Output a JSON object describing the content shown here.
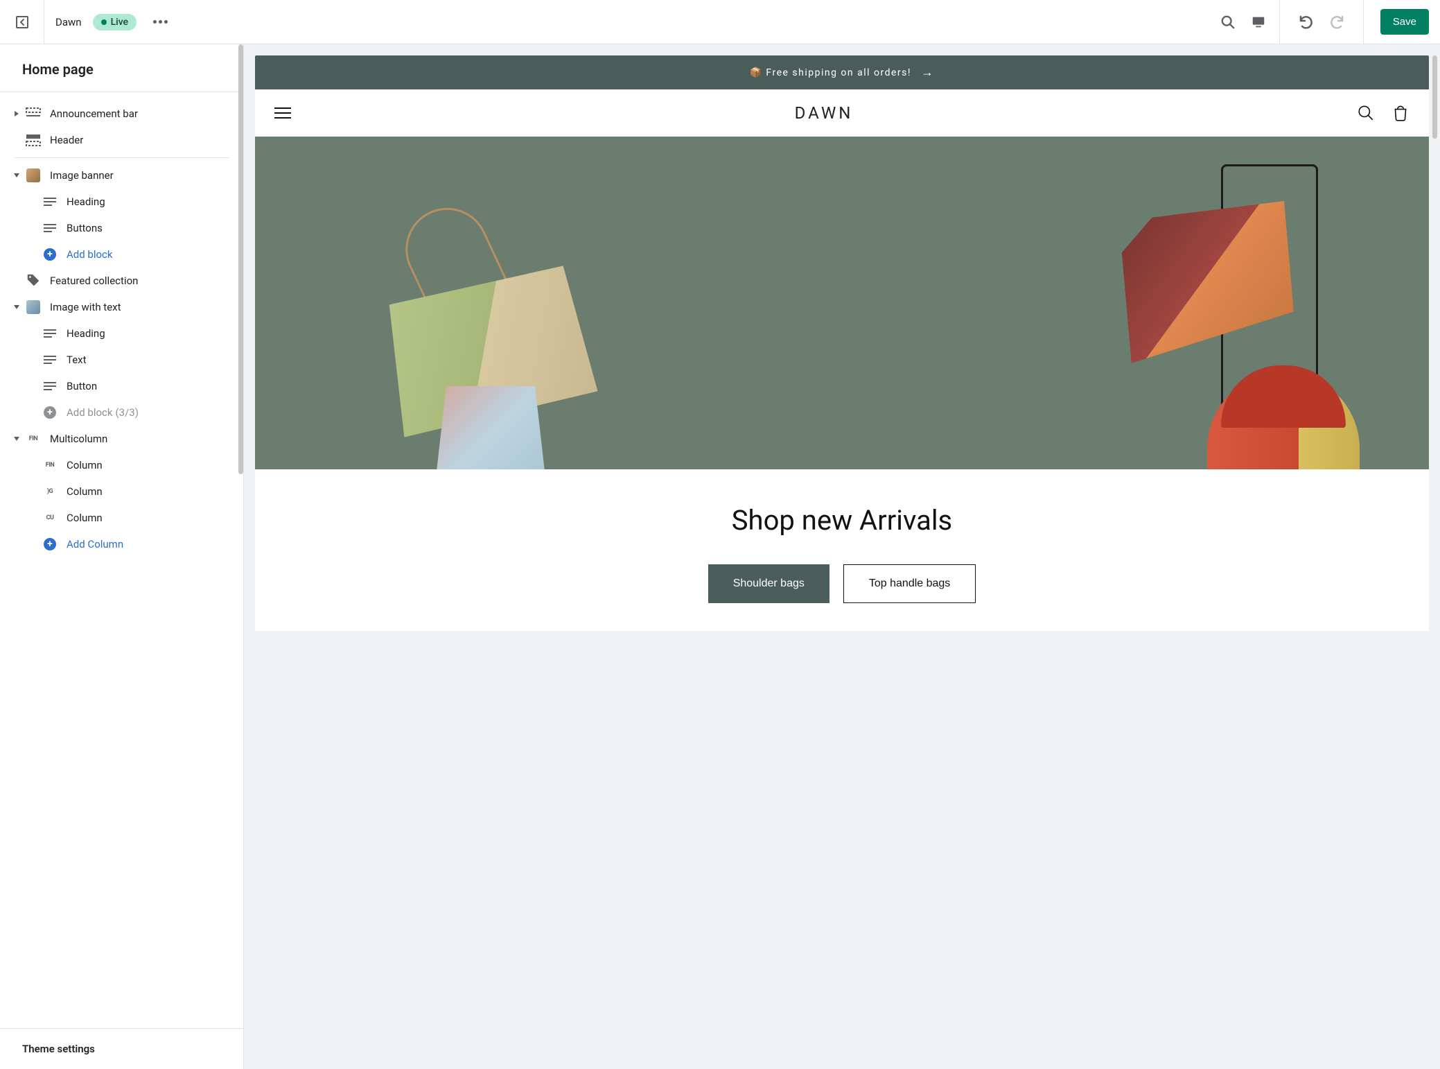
{
  "topbar": {
    "theme_name": "Dawn",
    "status_label": "Live",
    "save_label": "Save"
  },
  "sidebar": {
    "page_title": "Home page",
    "theme_settings_label": "Theme settings",
    "sections": {
      "announcement": "Announcement bar",
      "header": "Header",
      "image_banner": {
        "label": "Image banner",
        "blocks": [
          "Heading",
          "Buttons"
        ],
        "add": "Add block"
      },
      "featured_collection": "Featured collection",
      "image_with_text": {
        "label": "Image with text",
        "blocks": [
          "Heading",
          "Text",
          "Button"
        ],
        "add": "Add block",
        "add_count": "(3/3)"
      },
      "multicolumn": {
        "label": "Multicolumn",
        "blocks": [
          "Column",
          "Column",
          "Column"
        ],
        "block_prefixes": [
          "FIN",
          ")G",
          "CU"
        ],
        "add": "Add Column"
      }
    }
  },
  "preview": {
    "announcement_text": "📦 Free shipping on all orders!",
    "logo": "DAWN",
    "banner_heading": "Shop new Arrivals",
    "btn_primary": "Shoulder bags",
    "btn_secondary": "Top handle bags"
  }
}
